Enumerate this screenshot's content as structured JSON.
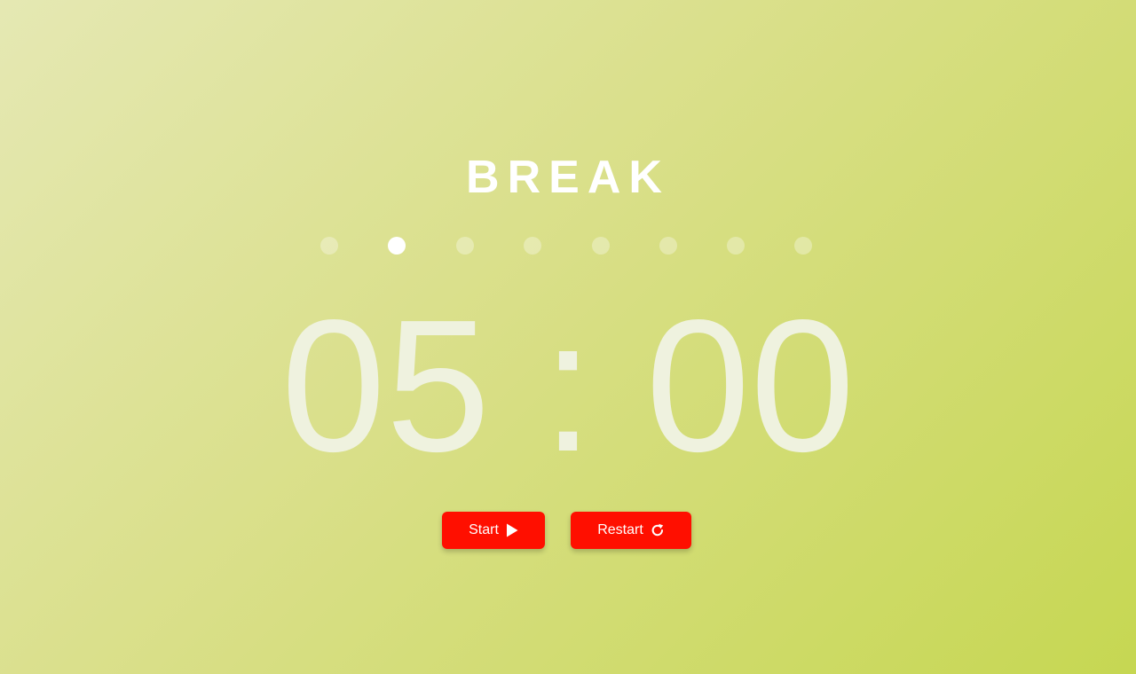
{
  "mode": {
    "title": "BREAK"
  },
  "progress": {
    "total_sessions": 8,
    "current_index": 1
  },
  "timer": {
    "minutes": "05",
    "separator": ":",
    "seconds": "00"
  },
  "controls": {
    "start_label": "Start",
    "start_icon": "play-icon",
    "restart_label": "Restart",
    "restart_icon": "restart-icon"
  },
  "colors": {
    "button_bg": "#ff0f00",
    "timer_text": "#eff2df",
    "title_text": "#ffffff"
  }
}
